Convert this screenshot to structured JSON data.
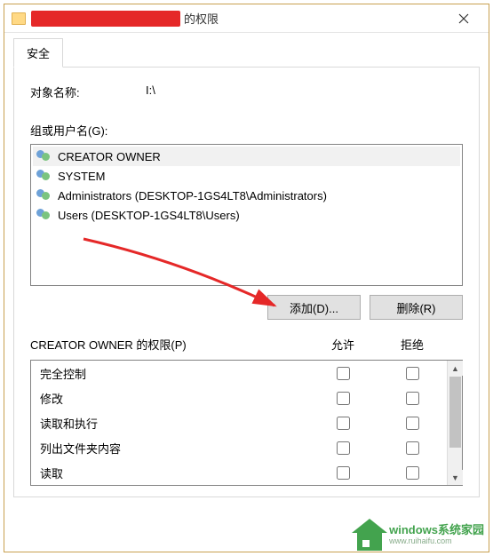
{
  "title_suffix": "的权限",
  "tab_security": "安全",
  "object_name_label": "对象名称:",
  "object_name_value": "I:\\",
  "groups_label": "组或用户名(G):",
  "users": [
    "CREATOR OWNER",
    "SYSTEM",
    "Administrators (DESKTOP-1GS4LT8\\Administrators)",
    "Users (DESKTOP-1GS4LT8\\Users)"
  ],
  "btn_add": "添加(D)...",
  "btn_remove": "删除(R)",
  "perm_title": "CREATOR OWNER 的权限(P)",
  "col_allow": "允许",
  "col_deny": "拒绝",
  "permissions": [
    "完全控制",
    "修改",
    "读取和执行",
    "列出文件夹内容",
    "读取"
  ],
  "watermark": {
    "main": "windows系统家园",
    "sub": "www.ruihaifu.com"
  }
}
